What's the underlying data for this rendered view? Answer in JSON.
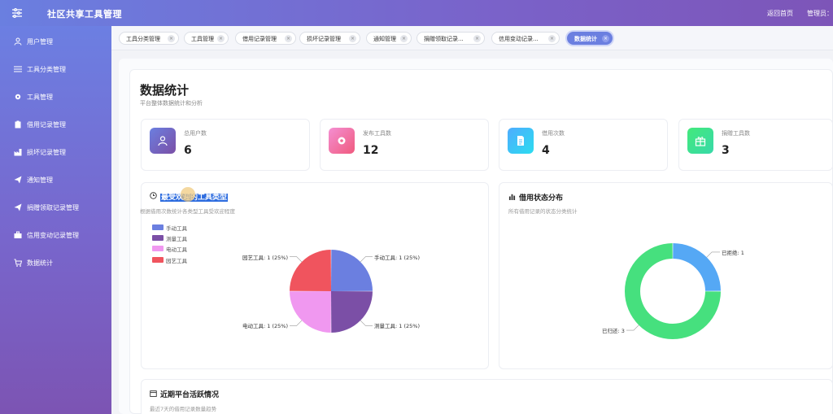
{
  "header": {
    "app_title": "社区共享工具管理",
    "back_home": "返回首页",
    "admin_label": "管理员："
  },
  "sidebar": {
    "items": [
      {
        "label": "用户管理",
        "icon": "user-icon"
      },
      {
        "label": "工具分类管理",
        "icon": "sliders-icon"
      },
      {
        "label": "工具管理",
        "icon": "gear-icon"
      },
      {
        "label": "借用记录管理",
        "icon": "clipboard-icon"
      },
      {
        "label": "损坏记录管理",
        "icon": "factory-icon"
      },
      {
        "label": "通知管理",
        "icon": "send-icon"
      },
      {
        "label": "捐赠领取记录管理",
        "icon": "send-icon"
      },
      {
        "label": "信用变动记录管理",
        "icon": "briefcase-icon"
      },
      {
        "label": "数据统计",
        "icon": "cart-icon"
      }
    ]
  },
  "tabs": [
    {
      "label": "工具分类管理"
    },
    {
      "label": "工具管理"
    },
    {
      "label": "借用记录管理"
    },
    {
      "label": "损坏记录管理"
    },
    {
      "label": "通知管理"
    },
    {
      "label": "捐赠领取记录..."
    },
    {
      "label": "信用变动记录..."
    },
    {
      "label": "数据统计",
      "active": true
    }
  ],
  "page": {
    "title": "数据统计",
    "subtitle": "平台整体数据统计和分析"
  },
  "stats": [
    {
      "label": "总用户数",
      "value": "6",
      "icon": "user-icon",
      "color": "#7b63c9"
    },
    {
      "label": "发布工具数",
      "value": "12",
      "icon": "gear-icon",
      "color": "#f06292"
    },
    {
      "label": "借用次数",
      "value": "4",
      "icon": "document-icon",
      "color": "#3fb6f5"
    },
    {
      "label": "捐赠工具数",
      "value": "3",
      "icon": "gift-icon",
      "color": "#43d98c"
    }
  ],
  "popular_tools": {
    "title": "最受欢迎的工具类型",
    "subtitle": "根据借用次数统计各类型工具受欢迎程度",
    "icon": "clock-icon"
  },
  "borrow_status": {
    "title": "借用状态分布",
    "subtitle": "所有借用记录的状态分类统计",
    "icon": "bar-chart-icon"
  },
  "recent_activity": {
    "title": "近期平台活跃情况",
    "subtitle": "最近7天的借用记录数量趋势",
    "icon": "calendar-icon"
  },
  "chart_data": [
    {
      "type": "pie",
      "title": "",
      "categories": [
        "手动工具",
        "测量工具",
        "电动工具",
        "园艺工具"
      ],
      "values": [
        1,
        1,
        1,
        1
      ],
      "percent_labels": [
        "手动工具: 1 (25%)",
        "测量工具: 1 (25%)",
        "电动工具: 1 (25%)",
        "园艺工具: 1 (25%)"
      ],
      "colors": [
        "#6b7fe0",
        "#7b4fa6",
        "#f098f0",
        "#f0545e"
      ],
      "legend": "top-left"
    },
    {
      "type": "pie",
      "title": "",
      "categories": [
        "已拒绝",
        "已归还"
      ],
      "values": [
        1,
        3
      ],
      "slice_labels": [
        "已拒绝: 1",
        "已归还: 3"
      ],
      "colors": [
        "#55a8f5",
        "#46e07e"
      ],
      "donut": true
    }
  ]
}
